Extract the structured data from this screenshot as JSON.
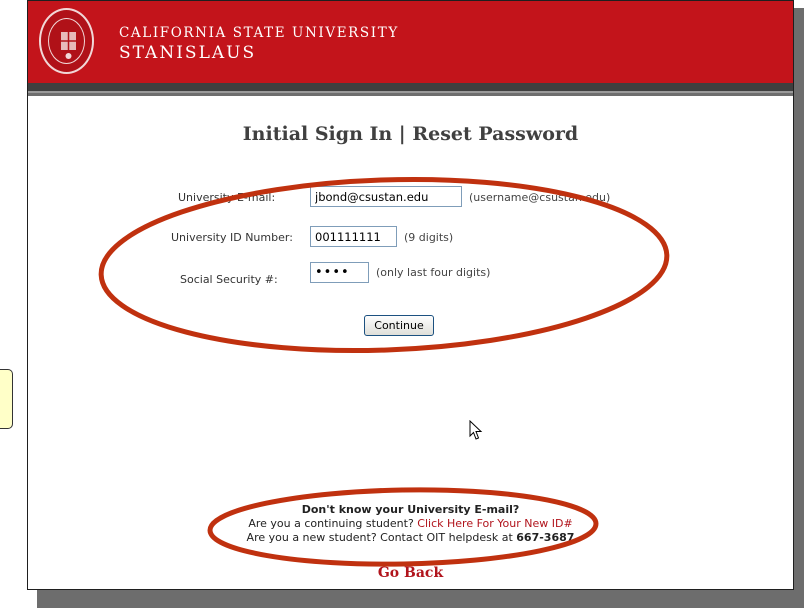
{
  "brand": {
    "line1": "CALIFORNIA STATE UNIVERSITY",
    "line2": "STANISLAUS"
  },
  "page": {
    "title": "Initial Sign In | Reset Password"
  },
  "form": {
    "email": {
      "label": "University E-mail:",
      "value": "jbond@csustan.edu",
      "hint": "(username@csustan.edu)"
    },
    "id_number": {
      "label": "University ID Number:",
      "value": "001111111",
      "hint": "(9 digits)"
    },
    "ssn": {
      "label": "Social Security #:",
      "value": "••••",
      "hint": "(only last four digits)"
    },
    "continue_label": "Continue"
  },
  "help": {
    "question": "Don't know your University E-mail?",
    "continuing_prefix": "Are you a continuing student?",
    "continuing_link": "Click Here For Your New ID#",
    "new_prefix": "Are you a new student? Contact OIT helpdesk at",
    "helpdesk_phone": "667-3687"
  },
  "nav": {
    "go_back": "Go Back"
  },
  "colors": {
    "brand_red": "#c3141b",
    "annotation_red": "#c0310f",
    "link_red": "#b1141c"
  },
  "icons": [
    "university-seal-icon",
    "mouse-cursor-icon"
  ]
}
